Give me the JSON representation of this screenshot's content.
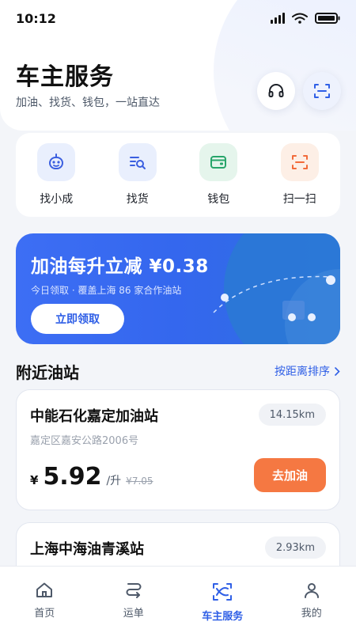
{
  "status_bar": {
    "time": "10:12"
  },
  "header": {
    "title": "车主服务",
    "subtitle": "加油、找货、钱包，一站直达",
    "support_icon": "headset-icon",
    "scan_icon": "scan-icon"
  },
  "quick_menu": [
    {
      "label": "找小成",
      "icon": "robot-icon",
      "bg": "#e9effd"
    },
    {
      "label": "找货",
      "icon": "search-list-icon",
      "bg": "#e9effd"
    },
    {
      "label": "钱包",
      "icon": "wallet-icon",
      "bg": "#e5f5ec"
    },
    {
      "label": "扫一扫",
      "icon": "scan-icon",
      "bg": "#fdefe6"
    }
  ],
  "promo": {
    "title": "加油每升立减 ¥0.38",
    "subtitle": "今日领取 · 覆盖上海 86 家合作油站",
    "button": "立即领取"
  },
  "nearby": {
    "title": "附近油站",
    "sort_label": "按距离排序",
    "stations": [
      {
        "name": "中能石化嘉定加油站",
        "distance": "14.15km",
        "address": "嘉定区嘉安公路2006号",
        "currency": "¥",
        "price": "5.92",
        "unit": "/升",
        "old_price": "¥7.05",
        "button": "去加油"
      },
      {
        "name": "上海中海油青溪站",
        "distance": "2.93km"
      }
    ]
  },
  "bottom_nav": [
    {
      "label": "首页",
      "icon": "home-icon",
      "active": false
    },
    {
      "label": "运单",
      "icon": "route-icon",
      "active": false
    },
    {
      "label": "车主服务",
      "icon": "car-service-icon",
      "active": true
    },
    {
      "label": "我的",
      "icon": "user-icon",
      "active": false
    }
  ],
  "colors": {
    "accent": "#2f5fe6",
    "orange": "#f57842",
    "banner": "#3d6ef4"
  }
}
